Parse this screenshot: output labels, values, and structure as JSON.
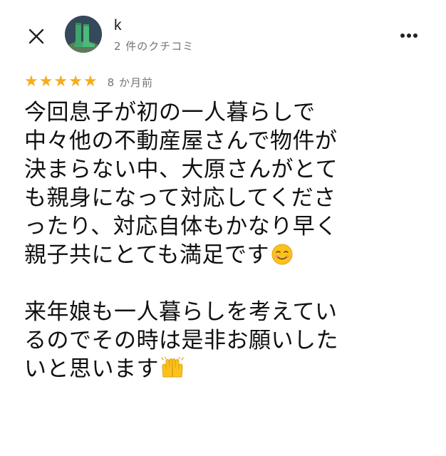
{
  "header": {
    "reviewer_name": "k",
    "review_count": "2 件のクチコミ"
  },
  "rating": {
    "stars": 5,
    "max_stars": 5,
    "date": "8 か月前"
  },
  "review": {
    "lines": [
      "今回息子が初の一人暮らしで",
      "中々他の不動産屋さんで物件が",
      "決まらない中、大原さんがとて",
      "も親身になって対応してくださ",
      "ったり、対応自体もかなり早く",
      "親子共にとても満足です",
      "",
      "来年娘も一人暮らしを考えてい",
      "るのでその時は是非お願いした",
      "いと思います"
    ]
  },
  "icons": {
    "close": "close-icon",
    "more": "more-vert-icon",
    "smiling_emoji": "smiling-face-emoji",
    "hands_emoji": "raised-hands-emoji",
    "star": "star-icon"
  },
  "colors": {
    "star": "#f6ad1d",
    "secondary_text": "#70757a",
    "primary_text": "#111111"
  }
}
